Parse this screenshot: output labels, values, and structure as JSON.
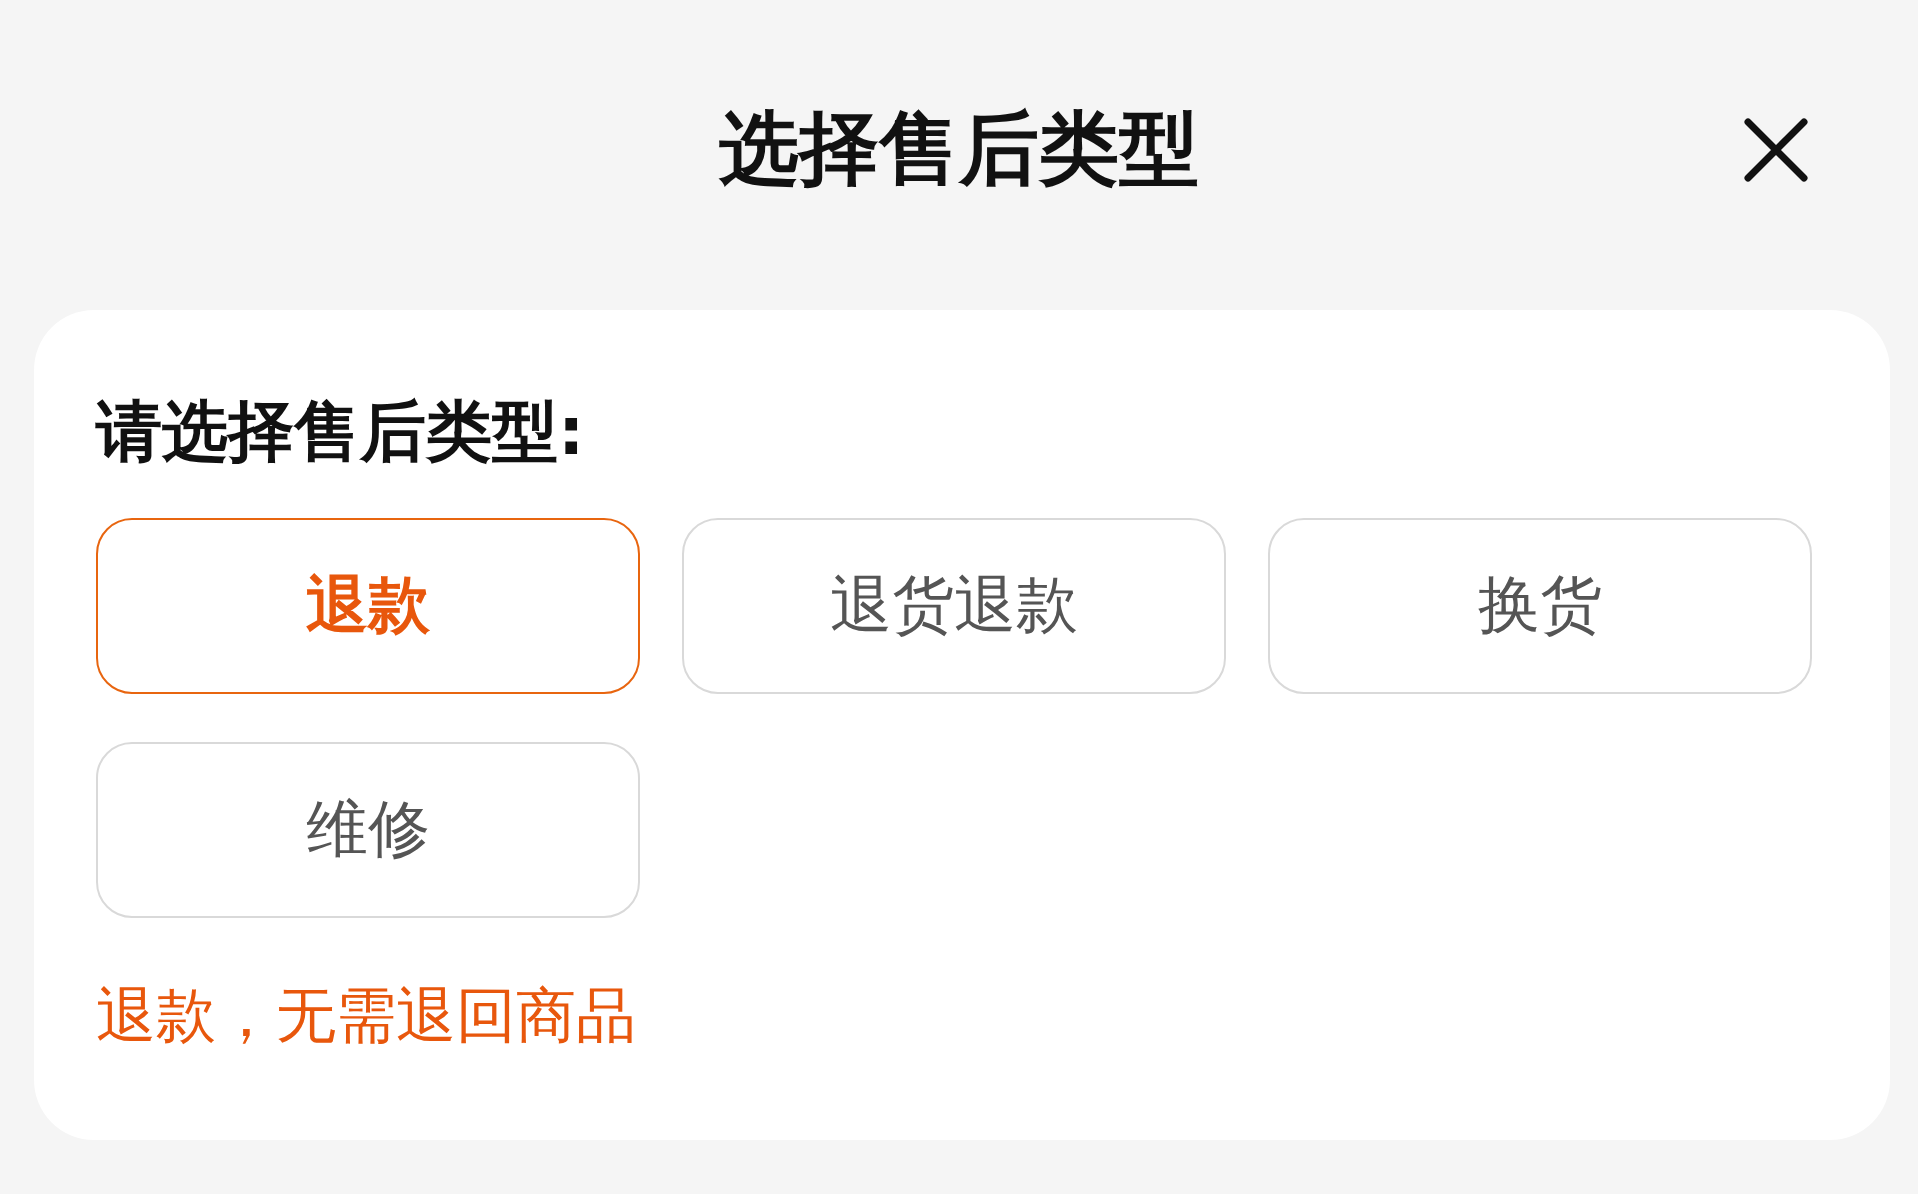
{
  "dialog": {
    "title": "选择售后类型"
  },
  "card": {
    "heading": "请选择售后类型:",
    "options": [
      {
        "label": "退款",
        "selected": true
      },
      {
        "label": "退货退款",
        "selected": false
      },
      {
        "label": "换货",
        "selected": false
      },
      {
        "label": "维修",
        "selected": false
      }
    ],
    "hint": "退款，无需退回商品"
  }
}
